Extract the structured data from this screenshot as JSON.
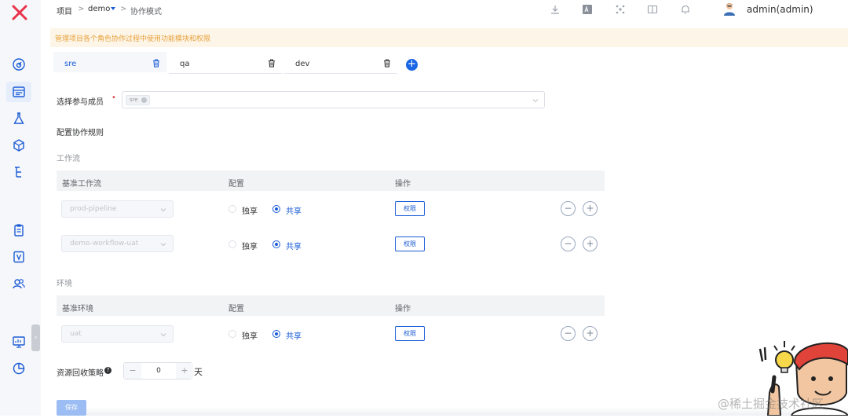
{
  "app": {
    "brand_color": "#e8334a",
    "accent_color": "#1a5bd6",
    "sidebar_icons": [
      "dashboard-icon",
      "project-icon",
      "flask-icon",
      "deploy-icon",
      "tree-icon",
      "clipboard-icon",
      "tasks-icon",
      "users-icon",
      "monitor-icon",
      "pie-chart-icon"
    ]
  },
  "header": {
    "breadcrumb": [
      "项目",
      "demo",
      "协作模式"
    ],
    "separator": ">",
    "icons": [
      "download-icon",
      "translate-icon",
      "network-icon",
      "book-icon",
      "bell-icon"
    ],
    "user_name": "admin(admin)"
  },
  "tip": "管理项目各个角色协作过程中使用功能模块和权限",
  "tabs": [
    {
      "label": "sre",
      "active": true
    },
    {
      "label": "qa",
      "active": false
    },
    {
      "label": "dev",
      "active": false
    }
  ],
  "add_tab": "+",
  "members": {
    "label": "选择参与成员",
    "required_mark": "•",
    "selected": [
      "sre"
    ]
  },
  "rules_title": "配置协作规则",
  "workflow": {
    "title": "工作流",
    "headers": [
      "基准工作流",
      "配置",
      "操作"
    ],
    "rows": [
      {
        "name": "prod-pipeline",
        "exclusive": "独享",
        "shared": "共享",
        "selected": "共享",
        "action": "权限"
      },
      {
        "name": "demo-workflow-uat",
        "exclusive": "独享",
        "shared": "共享",
        "selected": "共享",
        "action": "权限"
      }
    ]
  },
  "environment": {
    "title": "环境",
    "headers": [
      "基准环境",
      "配置",
      "操作"
    ],
    "rows": [
      {
        "name": "uat",
        "exclusive": "独享",
        "shared": "共享",
        "selected": "共享",
        "action": "权限"
      }
    ]
  },
  "row_buttons": {
    "remove": "−",
    "add": "+"
  },
  "recycle": {
    "label": "资源回收策略",
    "help": "?",
    "minus": "−",
    "value": "0",
    "plus": "+",
    "unit": "天"
  },
  "save_label": "保存",
  "watermark": "@稀土掘金技术社区"
}
